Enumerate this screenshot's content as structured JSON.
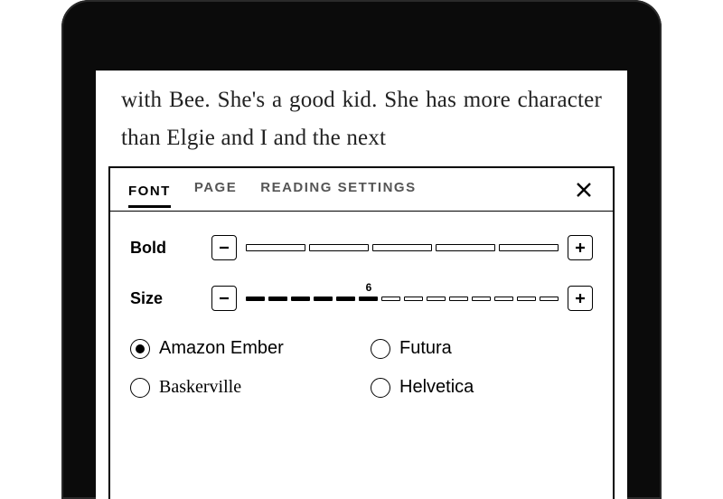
{
  "page_text": "with Bee. She's a good kid. She has more character than Elgie and I and the next",
  "tabs": {
    "font": "FONT",
    "page": "PAGE",
    "reading": "READING SETTINGS"
  },
  "active_tab": "FONT",
  "close_label": "Close",
  "bold": {
    "label": "Bold",
    "segments": 5,
    "value": 0
  },
  "size": {
    "label": "Size",
    "segments": 14,
    "value": 6,
    "value_label": "6"
  },
  "fonts": {
    "options": [
      "Amazon Ember",
      "Baskerville",
      "Futura",
      "Helvetica"
    ],
    "selected": "Amazon Ember"
  }
}
